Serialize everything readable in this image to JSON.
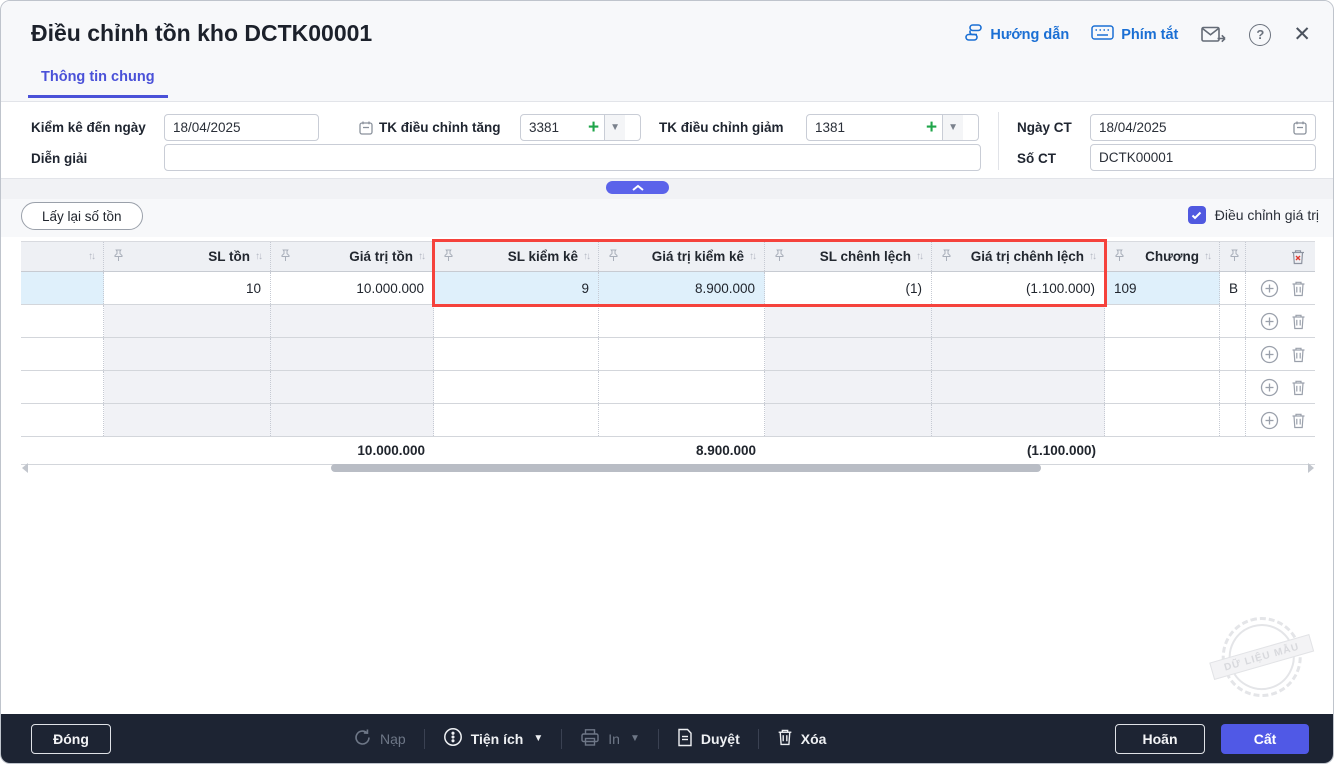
{
  "window": {
    "title": "Điều chỉnh tồn kho DCTK00001"
  },
  "header": {
    "tab": "Thông tin chung",
    "guide_link": "Hướng dẫn",
    "shortcuts_link": "Phím tắt"
  },
  "form": {
    "inventory_date": {
      "label": "Kiểm kê đến ngày",
      "value": "18/04/2025"
    },
    "increase_account": {
      "label": "TK điều chỉnh tăng",
      "value": "3381"
    },
    "decrease_account": {
      "label": "TK điều chỉnh giảm",
      "value": "1381"
    },
    "doc_date": {
      "label": "Ngày CT",
      "value": "18/04/2025"
    },
    "description": {
      "label": "Diễn giải",
      "value": ""
    },
    "doc_no": {
      "label": "Số CT",
      "value": "DCTK00001"
    }
  },
  "toolbar": {
    "reload_stock_label": "Lấy lại số tồn",
    "adjust_value_label": "Điều chỉnh giá trị",
    "adjust_value_checked": true
  },
  "table": {
    "columns": {
      "sl_ton": "SL tồn",
      "gia_tri_ton": "Giá trị tồn",
      "sl_kiem_ke": "SL kiểm kê",
      "gia_tri_kiem_ke": "Giá trị kiểm kê",
      "sl_chenh_lech": "SL chênh lệch",
      "gia_tri_chenh_lech": "Giá trị chênh lệch",
      "chuong": "Chương"
    },
    "rows": [
      {
        "sl_ton": "10",
        "gia_tri_ton": "10.000.000",
        "sl_kiem_ke": "9",
        "gia_tri_kiem_ke": "8.900.000",
        "sl_chenh_lech": "(1)",
        "gia_tri_chenh_lech": "(1.100.000)",
        "chuong": "109",
        "next_partial": "B"
      }
    ],
    "empty_rows": 4,
    "totals": {
      "gia_tri_ton": "10.000.000",
      "gia_tri_kiem_ke": "8.900.000",
      "gia_tri_chenh_lech": "(1.100.000)"
    }
  },
  "watermark": "DỮ LIỆU MẪU",
  "footer": {
    "close": "Đóng",
    "reload": "Nạp",
    "utilities": "Tiện ích",
    "print": "In",
    "approve": "Duyệt",
    "delete": "Xóa",
    "postpone": "Hoãn",
    "save": "Cất"
  },
  "colors": {
    "accent_purple": "#5059e6",
    "link_blue": "#1a6fd4",
    "active_cell_blue": "#dff0fb",
    "readonly_cell_gray": "#f1f2f6",
    "highlight_border_red": "#f5423c",
    "footer_bg": "#1d2433"
  }
}
